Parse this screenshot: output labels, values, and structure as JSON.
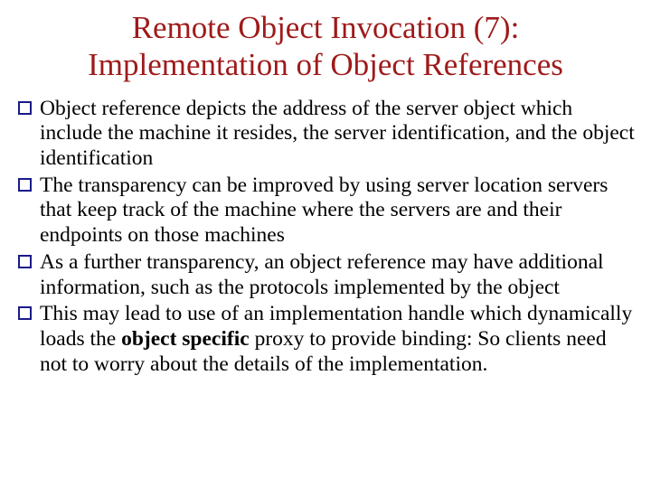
{
  "title_line1": "Remote Object Invocation (7):",
  "title_line2": "Implementation of Object References",
  "bullets": [
    {
      "text": "Object reference depicts the address of the server object which include the machine it resides, the server identification, and the object identification"
    },
    {
      "text": "The transparency can be improved by using server location servers that keep track of the machine where the servers are and their endpoints on those machines"
    },
    {
      "text": "As a further transparency, an object reference may have additional information, such as the protocols implemented by the object"
    },
    {
      "pre": "This may lead to use of an implementation  handle which dynamically loads the ",
      "bold": "object specific",
      "post": " proxy to provide binding: So clients need not to worry about the details of the implementation."
    }
  ]
}
